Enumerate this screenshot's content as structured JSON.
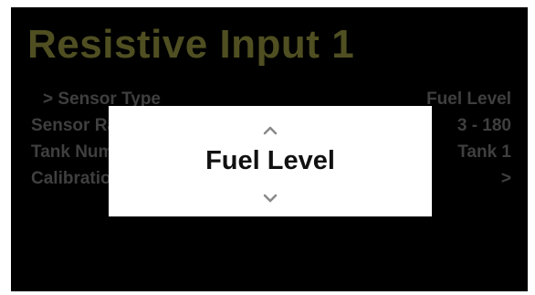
{
  "screen": {
    "title": "Resistive Input 1"
  },
  "menu": {
    "items": [
      {
        "label": "> Sensor Type",
        "value": "Fuel Level"
      },
      {
        "label": "Sensor Range",
        "value": "3 - 180"
      },
      {
        "label": "Tank Number",
        "value": "Tank 1"
      },
      {
        "label": "Calibration",
        "value": ">"
      }
    ]
  },
  "picker": {
    "selected_value": "Fuel Level",
    "up_icon": "chevron-up-icon",
    "down_icon": "chevron-down-icon"
  },
  "colors": {
    "background": "#000000",
    "title_dimmed": "#4f4f22",
    "menu_dimmed": "#3f3f3f",
    "dialog_background": "#ffffff",
    "dialog_text": "#111111"
  }
}
